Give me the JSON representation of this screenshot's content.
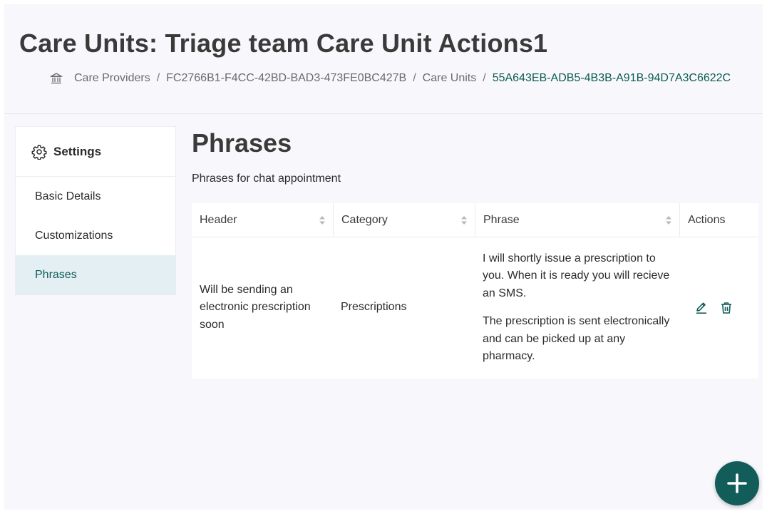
{
  "header": {
    "title": "Care Units: Triage team Care Unit Actions1",
    "breadcrumb": {
      "home_icon": "bank-icon",
      "items": [
        "Care Providers",
        "FC2766B1-F4CC-42BD-BAD3-473FE0BC427B",
        "Care Units"
      ],
      "current": "55A643EB-ADB5-4B3B-A91B-94D7A3C6622C",
      "separator": "/"
    }
  },
  "sidebar": {
    "title": "Settings",
    "title_icon": "gear-icon",
    "items": [
      {
        "label": "Basic Details",
        "active": false
      },
      {
        "label": "Customizations",
        "active": false
      },
      {
        "label": "Phrases",
        "active": true
      }
    ]
  },
  "main": {
    "title": "Phrases",
    "subtitle": "Phrases for chat appointment",
    "table": {
      "columns": [
        "Header",
        "Category",
        "Phrase",
        "Actions"
      ],
      "rows": [
        {
          "header": "Will be sending an electronic prescription soon",
          "category": "Prescriptions",
          "phrase": [
            "I will shortly issue a prescription to you. When it is ready you will recieve an SMS.",
            "The prescription is sent electronically and can be picked up at any pharmacy."
          ],
          "actions": [
            "edit-icon",
            "trash-icon"
          ]
        }
      ]
    }
  },
  "fab": {
    "icon": "plus-icon"
  },
  "colors": {
    "accent": "#125d5a",
    "active_bg": "#e3eff2",
    "page_bg": "#f8f8fc"
  }
}
